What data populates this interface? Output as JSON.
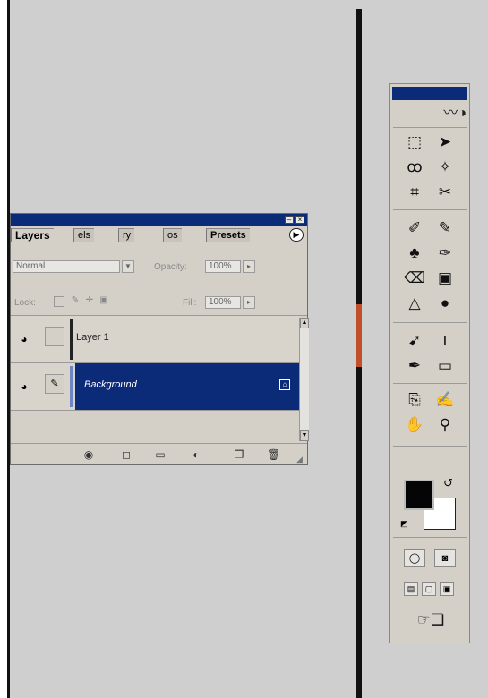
{
  "layers_panel": {
    "tabs": [
      "Layers",
      "els",
      "ry",
      "os",
      "Presets"
    ],
    "blend_mode": "Normal",
    "opacity_label": "Opacity:",
    "opacity_value": "100%",
    "lock_label": "Lock:",
    "fill_label": "Fill:",
    "fill_value": "100%",
    "layers": [
      {
        "name": "Layer 1",
        "selected": false
      },
      {
        "name": "Background",
        "selected": true
      }
    ]
  },
  "toolbox": {
    "tools": [
      "marquee-tool",
      "move-tool",
      "lasso-tool",
      "magic-wand-tool",
      "crop-tool",
      "slice-tool",
      "healing-brush-tool",
      "brush-tool",
      "clone-stamp-tool",
      "history-brush-tool",
      "eraser-tool",
      "gradient-tool",
      "blur-tool",
      "dodge-tool",
      "path-selection-tool",
      "type-tool",
      "pen-tool",
      "shape-tool",
      "notes-tool",
      "eyedropper-tool",
      "hand-tool",
      "zoom-tool"
    ],
    "type_tool_glyph": "T"
  },
  "colors": {
    "title_bar": "#0b2a78",
    "selected_row": "#0b2a78",
    "foreground": "#050505",
    "background": "#ffffff"
  }
}
